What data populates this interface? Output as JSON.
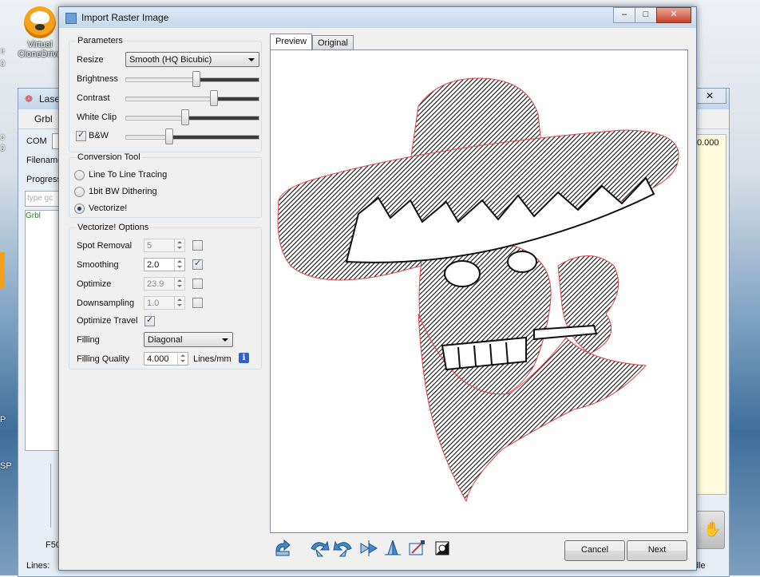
{
  "desktop": {
    "icon_label_line1": "Virtual",
    "icon_label_line2": "CloneDrive",
    "edge_texts": [
      "e",
      "0",
      "e",
      "0",
      "P",
      "SP"
    ]
  },
  "background_window": {
    "title": "Lase",
    "menu_item": "Grbl",
    "com_label": "COM",
    "filename_label": "Filename",
    "progress_label": "Progress",
    "input_placeholder": "type gc",
    "log_entry": "Grbl",
    "right_value": "0.000",
    "lines_label": "Lines:",
    "f_label": "F50",
    "bottom_right_text": "dle"
  },
  "dialog": {
    "title": "Import Raster Image",
    "window_buttons": {
      "minimize": "–",
      "maximize": "□",
      "close": "✕"
    },
    "parameters": {
      "group_title": "Parameters",
      "resize_label": "Resize",
      "resize_value": "Smooth (HQ Bicubic)",
      "brightness_label": "Brightness",
      "brightness_value": 0.6,
      "contrast_label": "Contrast",
      "contrast_value": 0.68,
      "whiteclip_label": "White Clip",
      "whiteclip_value": 0.45,
      "bw_label": "B&W",
      "bw_checked": true,
      "bw_slider_value": 0.33
    },
    "conversion": {
      "group_title": "Conversion Tool",
      "options": [
        "Line To Line Tracing",
        "1bit BW Dithering",
        "Vectorize!"
      ],
      "selected": 2
    },
    "vectorize": {
      "group_title": "Vectorize! Options",
      "spot_removal_label": "Spot Removal",
      "spot_removal_value": "5",
      "smoothing_label": "Smoothing",
      "smoothing_value": "2.0",
      "optimize_label": "Optimize",
      "optimize_value": "23.9",
      "downsampling_label": "Downsampling",
      "downsampling_value": "1.0",
      "optimize_travel_label": "Optimize Travel",
      "filling_label": "Filling",
      "filling_value": "Diagonal",
      "filling_quality_label": "Filling Quality",
      "filling_quality_value": "4.000",
      "filling_quality_unit": "Lines/mm",
      "info_glyph": "i"
    },
    "tabs": [
      "Preview",
      "Original"
    ],
    "toolbar_icons": [
      "rotate-ccw-icon",
      "rotate-left-icon",
      "rotate-right-icon",
      "flip-horizontal-icon",
      "flip-vertical-icon",
      "crop-icon",
      "invert-icon"
    ],
    "cancel_label": "Cancel",
    "next_label": "Next"
  }
}
